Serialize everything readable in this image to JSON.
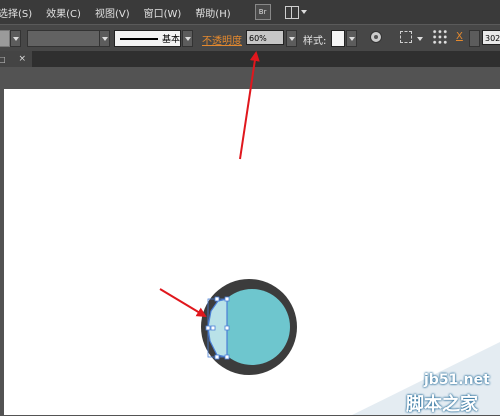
{
  "menubar": {
    "items": [
      "选择(S)",
      "效果(C)",
      "视图(V)",
      "窗口(W)",
      "帮助(H)"
    ],
    "bridge_label": "Br"
  },
  "controlbar": {
    "brush_label": "基本",
    "opacity_label": "不透明度",
    "opacity_value": "60%",
    "style_label": "样式:",
    "x_label": "X",
    "x_value": "302."
  },
  "tab": {
    "close_label": "×"
  },
  "watermark": {
    "url": "jb51.net",
    "name": "脚本之家"
  },
  "colors": {
    "outer_ring": "#3c3c3c",
    "inner_fill": "#6ec6ce",
    "selection": "#4a7fd6",
    "crescent": "#b9e2e8",
    "arrow": "#e0171d",
    "opacity_label": "#e4892e"
  }
}
